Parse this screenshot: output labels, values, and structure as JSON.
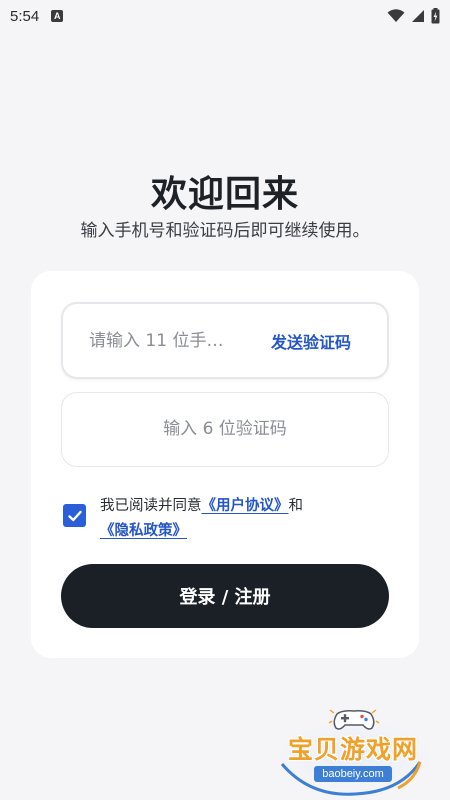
{
  "status_bar": {
    "time": "5:54",
    "notification_icon_letter": "A",
    "icons": [
      "wifi-icon",
      "cell-signal-icon",
      "battery-icon"
    ]
  },
  "header": {
    "title": "欢迎回来",
    "subtitle": "输入手机号和验证码后即可继续使用。"
  },
  "form": {
    "phone": {
      "placeholder": "请输入 11 位手…",
      "value": ""
    },
    "send_code_label": "发送验证码",
    "code": {
      "placeholder": "输入 6 位验证码",
      "value": ""
    },
    "agreement": {
      "checked": true,
      "prefix": "我已阅读并同意",
      "user_agreement_label": "《用户协议》",
      "conjunction": "和",
      "privacy_policy_label": "《隐私政策》"
    },
    "submit_label": "登录 / 注册"
  },
  "watermark": {
    "title": "宝贝游戏网",
    "url": "baobeiy.com"
  },
  "colors": {
    "background": "#f5f5f8",
    "card": "#ffffff",
    "accent_blue": "#2456c8",
    "checkbox_blue": "#2b5fd9",
    "button_dark": "#1b2027",
    "watermark_orange": "#f0a12a"
  }
}
